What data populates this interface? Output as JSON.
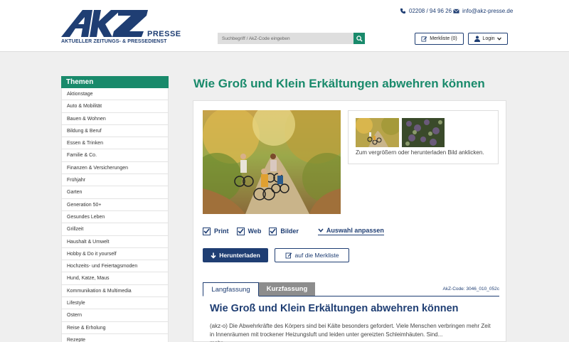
{
  "header": {
    "logo_text": "AKZ",
    "logo_presse": "PRESSE",
    "logo_sub": "AKTUELLER ZEITUNGS- & PRESSEDIENST",
    "phone": "02208 / 94 96 26",
    "email": "info@akz-presse.de",
    "search_placeholder": "Suchbegriff / AkZ-Code eingeben",
    "merkliste_label": "Merkliste (0)",
    "login_label": "Login"
  },
  "sidebar": {
    "title": "Themen",
    "items": [
      "Aktionstage",
      "Auto & Mobilität",
      "Bauen & Wohnen",
      "Bildung & Beruf",
      "Essen & Trinken",
      "Familie & Co.",
      "Finanzen & Versicherungen",
      "Frühjahr",
      "Garten",
      "Generation 50+",
      "Gesundes Leben",
      "Grillzeit",
      "Haushalt & Umwelt",
      "Hobby & Do it yourself",
      "Hochzeits- und Feiertagsmoden",
      "Hund, Katze, Maus",
      "Kommunikation & Multimedia",
      "Lifestyle",
      "Ostern",
      "Reise & Erholung",
      "Rezepte"
    ]
  },
  "main": {
    "title": "Wie Groß und Klein Erkältungen abwehren können",
    "thumb_caption": "Zum vergrößern oder herunterladen Bild anklicken.",
    "options": {
      "print": "Print",
      "web": "Web",
      "bilder": "Bilder",
      "anpassen": "Auswahl anpassen"
    },
    "download_label": "Herunterladen",
    "merkliste_label": "auf die Merkliste",
    "tab_lang": "Langfassung",
    "tab_kurz": "Kurzfassung",
    "akz_code": "AkZ-Code: 3046_010_052c",
    "article_title": "Wie Groß und Klein Erkältungen abwehren können",
    "article_body": "(akz-o) Die Abwehrkräfte des Körpers sind bei Kälte besonders gefordert. Viele Menschen verbringen mehr Zeit in Innenräumen mit trockener Heizungsluft und leiden unter gereizten Schleimhäuten. Sind...",
    "article_more": "mehr"
  },
  "colors": {
    "brand_green": "#198a6b",
    "brand_blue": "#1f3e73"
  }
}
